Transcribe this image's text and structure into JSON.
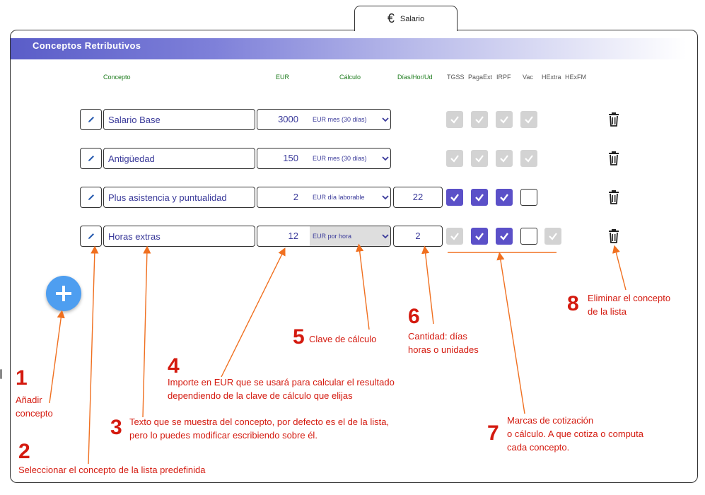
{
  "tab": {
    "icon": "euro-icon",
    "label": "Salario"
  },
  "section": {
    "title": "Conceptos Retributivos"
  },
  "columns": {
    "concepto": "Concepto",
    "eur": "EUR",
    "calculo": "Cálculo",
    "dias": "Días/Hor/Ud",
    "tgss": "TGSS",
    "pagaext": "PagaExt",
    "irpf": "IRPF",
    "vac": "Vac",
    "hextra": "HExtra",
    "hexfm": "HExFM"
  },
  "rows": [
    {
      "concept": "Salario Base",
      "eur": "3000",
      "calc": "EUR mes (30 días)",
      "qty": "",
      "checks": [
        "disabled-checked",
        "disabled-checked",
        "disabled-checked",
        "disabled-checked"
      ]
    },
    {
      "concept": "Antigüedad",
      "eur": "150",
      "calc": "EUR mes (30 días)",
      "qty": "",
      "checks": [
        "disabled-checked",
        "disabled-checked",
        "disabled-checked",
        "disabled-checked"
      ]
    },
    {
      "concept": "Plus asistencia y puntualidad",
      "eur": "2",
      "calc": "EUR día laborable",
      "qty": "22",
      "checks": [
        "checked",
        "checked",
        "checked",
        "unchecked"
      ]
    },
    {
      "concept": "Horas extras",
      "eur": "12",
      "calc": "EUR por hora",
      "qty": "2",
      "checks": [
        "disabled-checked",
        "checked",
        "checked",
        "unchecked",
        "disabled-checked"
      ]
    }
  ],
  "colors": {
    "accent": "#5b50c8",
    "annotation": "#d41a0f",
    "fab": "#4e9ef0",
    "header_label": "#1a7a1a"
  },
  "annotations": {
    "n1": "1",
    "t1": "Añadir\nconcepto",
    "n2": "2",
    "t2": "Seleccionar el concepto de la lista predefinida",
    "n3": "3",
    "t3a": "Texto que se muestra del concepto, por defecto es el de la lista,",
    "t3b": "pero lo puedes modificar escribiendo sobre él.",
    "n4": "4",
    "t4a": "Importe en EUR que se usará para calcular el resultado",
    "t4b": "dependiendo de la clave de cálculo que elijas",
    "n5": "5",
    "t5": "Clave de cálculo",
    "n6": "6",
    "t6a": "Cantidad: días",
    "t6b": "horas o unidades",
    "n7": "7",
    "t7a": "Marcas de cotización",
    "t7b": "o cálculo. A que cotiza o computa",
    "t7c": "cada concepto.",
    "n8": "8",
    "t8a": "Eliminar el concepto",
    "t8b": "de la lista"
  }
}
